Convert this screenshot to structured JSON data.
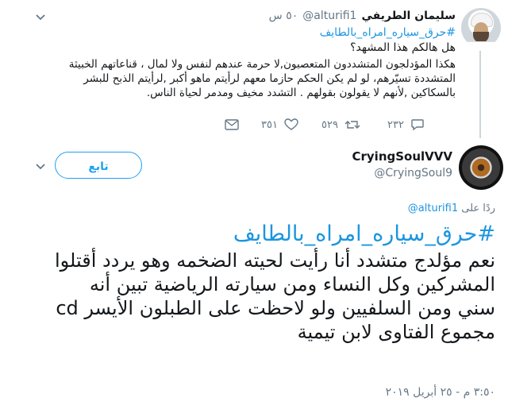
{
  "parent_tweet": {
    "name": "سليمان الطريفي",
    "handle": "@alturifi1",
    "time": "٥٠ س",
    "hashtag": "#حرق_سياره_امراه_بالطايف",
    "question": "هل هالكم هذا المشهد؟",
    "body": "هكذا المؤدلجون المتشددون المتعصبون,لا حرمة عندهم لنفس ولا لمال ، قناعاتهم الخبيثة المتشددة تسيّرهم، لو لم يكن الحكم حازما معهم لرأيتم ماهو أكبر ,لرأيتم الذبح للبشر بالسكاكين ,لأنهم لا يقولون بقولهم . التشدد مخيف ومدمر لحياة الناس.",
    "reply_count": "٢٣٢",
    "retweet_count": "٥٢٩",
    "like_count": "٣٥١"
  },
  "reply_tweet": {
    "name": "CryingSoulVVV",
    "handle": "@CryingSoul9",
    "follow_label": "تابع",
    "replying_to_prefix": "ردًا على",
    "replying_to_handle": "@alturifi1",
    "hashtag": "#حرق_سياره_امراه_بالطايف",
    "body": "نعم مؤلدج متشدد أنا رأيت لحيته الضخمه وهو يردد أقتلوا المشركين وكل النساء ومن سيارته الرياضية تبين أنه سني ومن السلفيين ولو لاحظت على الطبلون الأيسر cd مجموع الفتاوى لابن تيمية",
    "timestamp": "٣:٥٠ م - ٢٥ أبريل ٢٠١٩"
  },
  "colors": {
    "accent": "#1da1f2",
    "link": "#1b95e0",
    "muted": "#657786",
    "text": "#14171a"
  },
  "icons": {
    "reply": "reply-icon",
    "retweet": "retweet-icon",
    "like": "heart-icon",
    "dm": "envelope-icon",
    "menu": "chevron-down-icon"
  }
}
